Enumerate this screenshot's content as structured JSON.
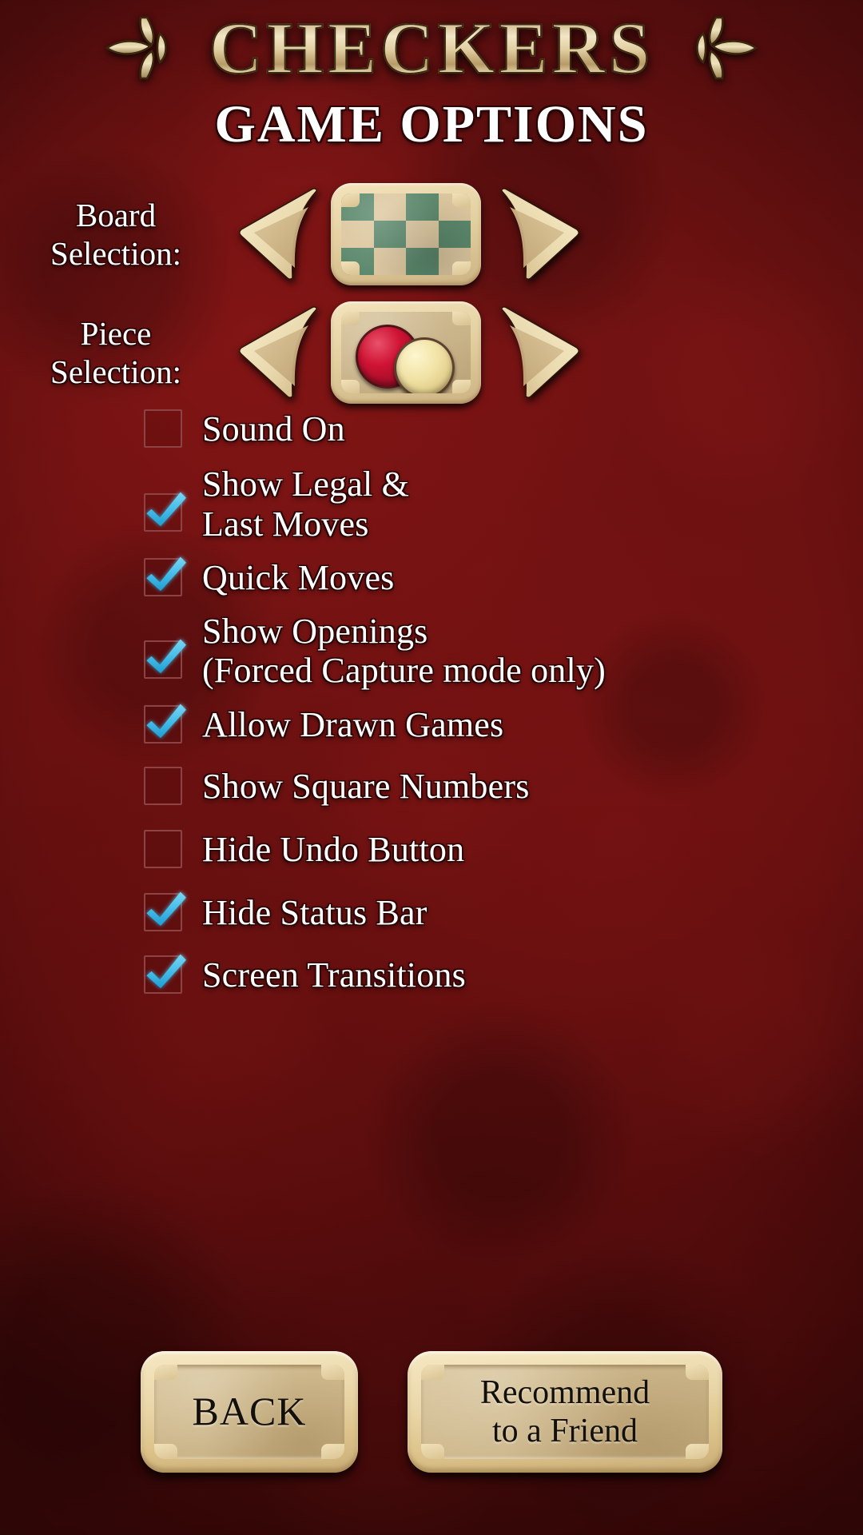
{
  "app": {
    "logo_text": "CHECKERS",
    "ornament_left": "fleur-ornament-left",
    "ornament_right": "fleur-ornament-right",
    "page_title": "GAME OPTIONS"
  },
  "colors": {
    "background_red": "#6b0f0f",
    "background_red_dark": "#400808",
    "gold": "#e2cfa2",
    "wood_tan": "#ddc8a0",
    "board_green": "#5d8a6e",
    "piece_red": "#cf1334",
    "piece_cream": "#f2e4a8",
    "check_blue": "#4dbee8",
    "checkbox_border": "#8d4343",
    "label_white": "#ffffff",
    "button_text": "#13100c"
  },
  "selectors": [
    {
      "id": "board-selection",
      "label_line1": "Board",
      "label_line2": "Selection:",
      "prev_label": "previous board",
      "next_label": "next board",
      "preview_type": "checkerboard"
    },
    {
      "id": "piece-selection",
      "label_line1": "Piece",
      "label_line2": "Selection:",
      "prev_label": "previous piece set",
      "next_label": "next piece set",
      "preview_type": "checker-pieces"
    }
  ],
  "options": [
    {
      "id": "sound-on",
      "label_line1": "Sound On",
      "label_line2": "",
      "checked": false
    },
    {
      "id": "show-legal",
      "label_line1": "Show Legal &",
      "label_line2": "Last Moves",
      "checked": true
    },
    {
      "id": "quick-moves",
      "label_line1": "Quick Moves",
      "label_line2": "",
      "checked": true
    },
    {
      "id": "show-openings",
      "label_line1": "Show Openings",
      "label_line2": "(Forced Capture mode only)",
      "checked": true
    },
    {
      "id": "allow-drawn-games",
      "label_line1": "Allow Drawn Games",
      "label_line2": "",
      "checked": true
    },
    {
      "id": "show-square-numbers",
      "label_line1": "Show Square Numbers",
      "label_line2": "",
      "checked": false
    },
    {
      "id": "hide-undo-button",
      "label_line1": "Hide Undo Button",
      "label_line2": "",
      "checked": false
    },
    {
      "id": "hide-status-bar",
      "label_line1": "Hide Status Bar",
      "label_line2": "",
      "checked": true
    },
    {
      "id": "screen-transitions",
      "label_line1": "Screen Transitions",
      "label_line2": "",
      "checked": true
    }
  ],
  "buttons": {
    "back": {
      "line1": "BACK",
      "line2": ""
    },
    "recommend": {
      "line1": "Recommend",
      "line2": "to a Friend"
    }
  }
}
